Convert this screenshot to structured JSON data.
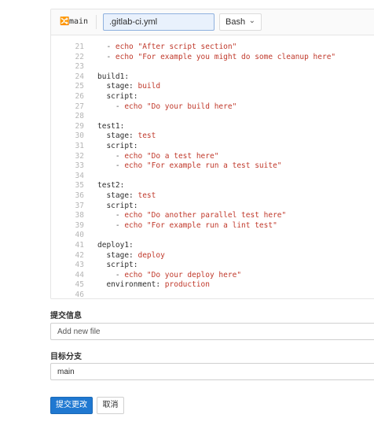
{
  "toolbar": {
    "branch_icon": "branch-icon",
    "branch": "main",
    "filename": ".gitlab-ci.yml",
    "language": "Bash",
    "language_chevron": "⌄"
  },
  "code_lines": [
    {
      "n": "21",
      "parts": [
        [
          "g",
          "  - "
        ],
        [
          "s",
          "echo \"After script section\""
        ]
      ]
    },
    {
      "n": "22",
      "parts": [
        [
          "g",
          "  - "
        ],
        [
          "s",
          "echo \"For example you might do some cleanup here\""
        ]
      ]
    },
    {
      "n": "23",
      "parts": []
    },
    {
      "n": "24",
      "parts": [
        [
          "k",
          "build1:"
        ]
      ]
    },
    {
      "n": "25",
      "parts": [
        [
          "k",
          "  stage: "
        ],
        [
          "s",
          "build"
        ]
      ]
    },
    {
      "n": "26",
      "parts": [
        [
          "k",
          "  script:"
        ]
      ]
    },
    {
      "n": "27",
      "parts": [
        [
          "g",
          "    - "
        ],
        [
          "s",
          "echo \"Do your build here\""
        ]
      ]
    },
    {
      "n": "28",
      "parts": []
    },
    {
      "n": "29",
      "parts": [
        [
          "k",
          "test1:"
        ]
      ]
    },
    {
      "n": "30",
      "parts": [
        [
          "k",
          "  stage: "
        ],
        [
          "s",
          "test"
        ]
      ]
    },
    {
      "n": "31",
      "parts": [
        [
          "k",
          "  script:"
        ]
      ]
    },
    {
      "n": "32",
      "parts": [
        [
          "g",
          "    - "
        ],
        [
          "s",
          "echo \"Do a test here\""
        ]
      ]
    },
    {
      "n": "33",
      "parts": [
        [
          "g",
          "    - "
        ],
        [
          "s",
          "echo \"For example run a test suite\""
        ]
      ]
    },
    {
      "n": "34",
      "parts": []
    },
    {
      "n": "35",
      "parts": [
        [
          "k",
          "test2:"
        ]
      ]
    },
    {
      "n": "36",
      "parts": [
        [
          "k",
          "  stage: "
        ],
        [
          "s",
          "test"
        ]
      ]
    },
    {
      "n": "37",
      "parts": [
        [
          "k",
          "  script:"
        ]
      ]
    },
    {
      "n": "38",
      "parts": [
        [
          "g",
          "    - "
        ],
        [
          "s",
          "echo \"Do another parallel test here\""
        ]
      ]
    },
    {
      "n": "39",
      "parts": [
        [
          "g",
          "    - "
        ],
        [
          "s",
          "echo \"For example run a lint test\""
        ]
      ]
    },
    {
      "n": "40",
      "parts": []
    },
    {
      "n": "41",
      "parts": [
        [
          "k",
          "deploy1:"
        ]
      ]
    },
    {
      "n": "42",
      "parts": [
        [
          "k",
          "  stage: "
        ],
        [
          "s",
          "deploy"
        ]
      ]
    },
    {
      "n": "43",
      "parts": [
        [
          "k",
          "  script:"
        ]
      ]
    },
    {
      "n": "44",
      "parts": [
        [
          "g",
          "    - "
        ],
        [
          "s",
          "echo \"Do your deploy here\""
        ]
      ]
    },
    {
      "n": "45",
      "parts": [
        [
          "k",
          "  environment: "
        ],
        [
          "s",
          "production"
        ]
      ]
    },
    {
      "n": "46",
      "parts": []
    }
  ],
  "form": {
    "commit_message_label": "提交信息",
    "commit_message_placeholder": "Add new file",
    "target_branch_label": "目标分支",
    "target_branch_value": "main",
    "submit_label": "提交更改",
    "cancel_label": "取消"
  },
  "colors": {
    "primary": "#1f78d1",
    "string": "#c0392b"
  }
}
